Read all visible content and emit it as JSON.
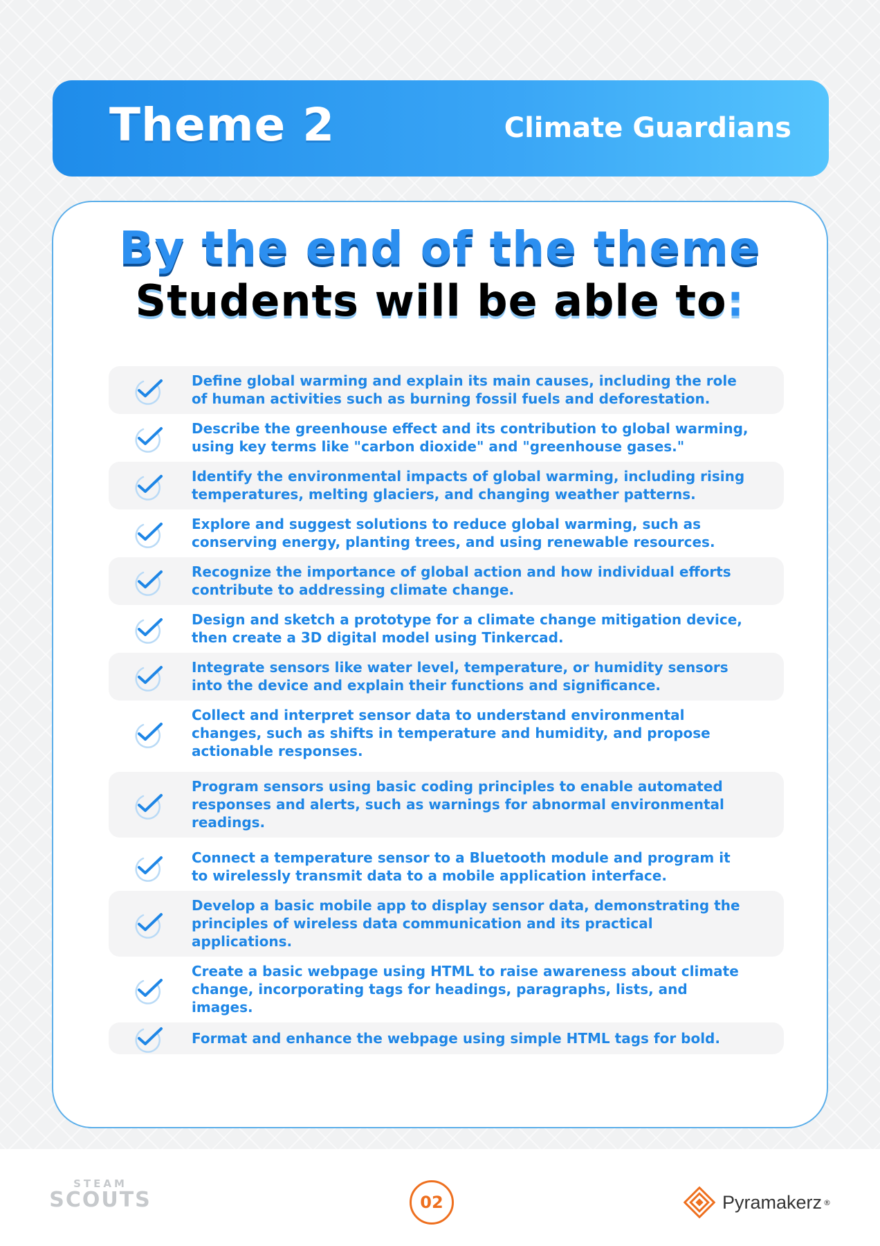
{
  "header": {
    "theme_number": "Theme 2",
    "theme_name": "Climate Guardians"
  },
  "card": {
    "headline_1": "By the end of the theme",
    "headline_2": "Students will be able to",
    "headline_2_colon": ":",
    "objectives": [
      "Define global warming and explain its main causes, including the role of human activities such as burning fossil fuels and deforestation.",
      "Describe the greenhouse effect and its contribution to global warming, using key terms like \"carbon dioxide\" and \"greenhouse gases.\"",
      "Identify the environmental impacts of global warming, including rising temperatures, melting glaciers, and changing weather patterns.",
      "Explore and suggest solutions to reduce global warming, such as conserving energy, planting trees, and using renewable resources.",
      "Recognize the importance of global action and how individual efforts contribute to addressing climate change.",
      "Design and sketch a prototype for a climate change mitigation device, then create a 3D digital model using Tinkercad.",
      "Integrate sensors like water level, temperature, or humidity sensors into the device and explain their functions and significance.",
      "Collect and interpret sensor data to understand environmental changes, such as shifts in temperature and humidity, and propose actionable responses.",
      "Program sensors using basic coding principles to enable automated responses and alerts, such as warnings for abnormal environmental readings.",
      "Connect a temperature sensor to a Bluetooth module and program it to wirelessly transmit data to a mobile application interface.",
      "Develop a basic mobile app to display sensor data, demonstrating the principles of wireless data communication and its practical applications.",
      "Create a basic webpage using HTML to raise awareness about climate change, incorporating tags for headings, paragraphs, lists, and images.",
      "Format and enhance the webpage using simple HTML tags for bold."
    ]
  },
  "footer": {
    "steam_logo_top": "STEAM",
    "steam_logo_bottom": "SCOUTS",
    "page_number": "02",
    "brand_name": "Pyramakerz",
    "brand_mark": "®"
  },
  "colors": {
    "primary_blue": "#1e86e6",
    "accent_orange": "#ee6f1e"
  },
  "icons": {
    "objective_bullet": "check-icon",
    "brand": "pyramid-logo-icon"
  }
}
